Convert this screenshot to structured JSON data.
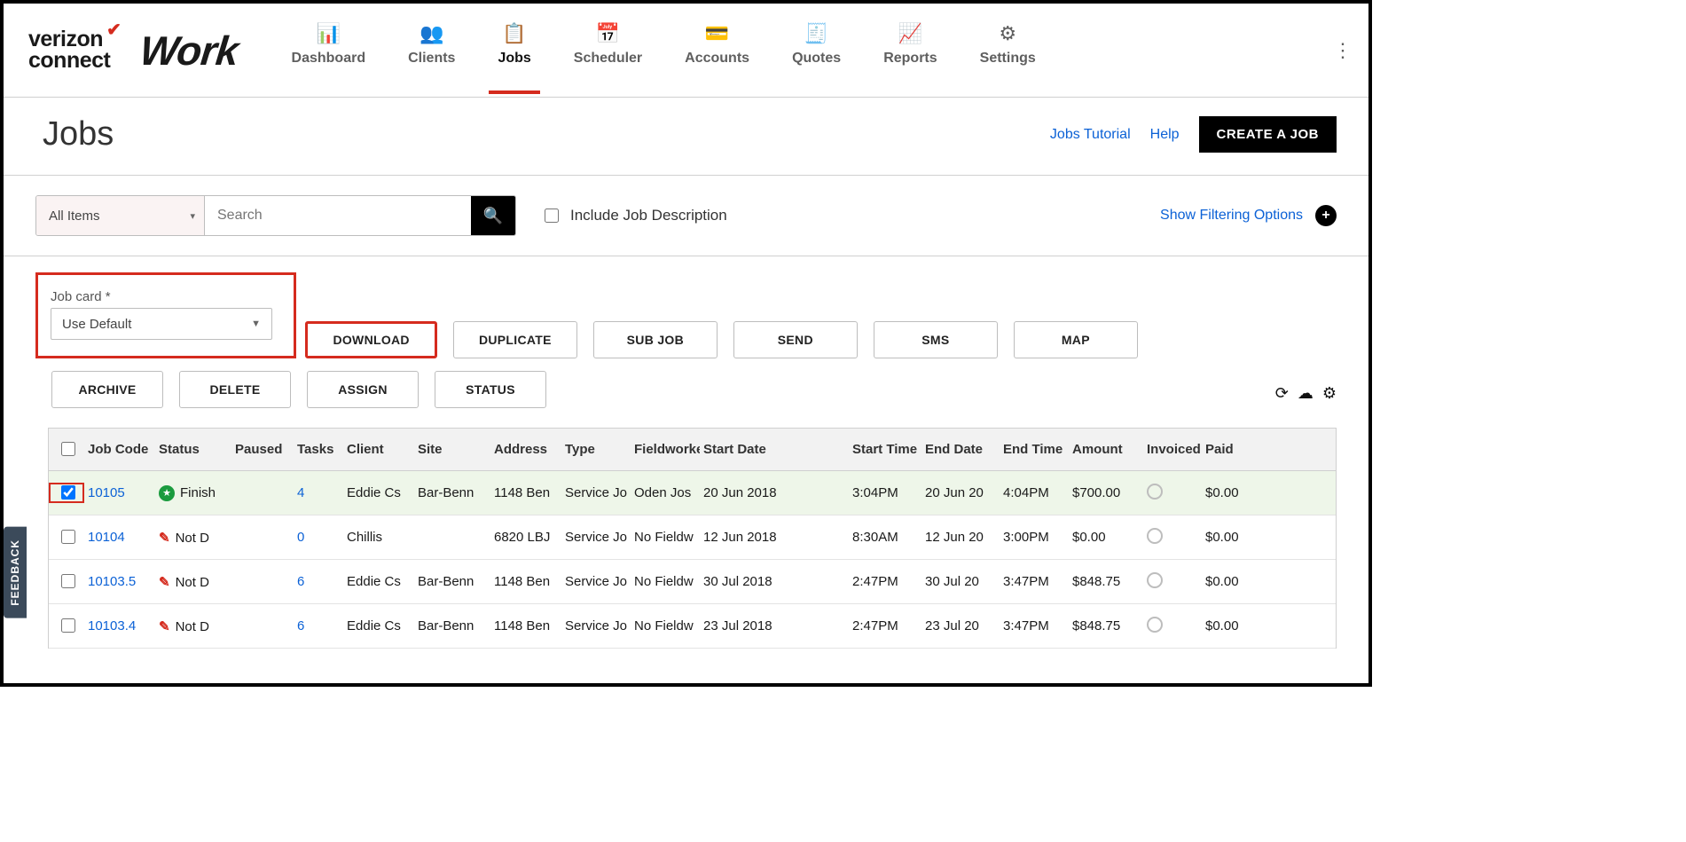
{
  "brand": {
    "line1": "verizon",
    "line2": "connect",
    "app": "Work"
  },
  "nav": [
    {
      "label": "Dashboard",
      "icon": "📊"
    },
    {
      "label": "Clients",
      "icon": "👥"
    },
    {
      "label": "Jobs",
      "icon": "📋",
      "active": true
    },
    {
      "label": "Scheduler",
      "icon": "📅"
    },
    {
      "label": "Accounts",
      "icon": "💳"
    },
    {
      "label": "Quotes",
      "icon": "🧾"
    },
    {
      "label": "Reports",
      "icon": "📈"
    },
    {
      "label": "Settings",
      "icon": "⚙"
    }
  ],
  "page": {
    "title": "Jobs",
    "tutorial": "Jobs Tutorial",
    "help": "Help",
    "create": "CREATE A JOB"
  },
  "filter": {
    "scope": "All Items",
    "search_placeholder": "Search",
    "include_desc": "Include Job Description",
    "show_filters": "Show Filtering Options"
  },
  "toolbar": {
    "jobcard_label": "Job card *",
    "jobcard_value": "Use Default",
    "download": "DOWNLOAD",
    "duplicate": "DUPLICATE",
    "subjob": "SUB JOB",
    "send": "SEND",
    "sms": "SMS",
    "map": "MAP",
    "archive": "ARCHIVE",
    "delete": "DELETE",
    "assign": "ASSIGN",
    "status": "STATUS"
  },
  "columns": [
    "",
    "Job Code",
    "Status",
    "Paused",
    "Tasks",
    "Client",
    "Site",
    "Address",
    "Type",
    "Fieldworker",
    "Start Date",
    "Start Time",
    "End Date",
    "End Time",
    "Amount",
    "Invoiced",
    "Paid"
  ],
  "rows": [
    {
      "checked": true,
      "code": "10105",
      "status": "Finish",
      "status_kind": "fin",
      "tasks": "4",
      "client": "Eddie Cs",
      "site": "Bar-Benn",
      "address": "1148 Ben",
      "type": "Service Jo",
      "fw": "Oden Jos",
      "sdate": "20 Jun 2018",
      "stime": "3:04PM",
      "edate": "20 Jun 20",
      "etime": "4:04PM",
      "amount": "$700.00",
      "paid": "$0.00"
    },
    {
      "checked": false,
      "code": "10104",
      "status": "Not D",
      "status_kind": "not",
      "tasks": "0",
      "client": "Chillis",
      "site": "",
      "address": "6820 LBJ",
      "type": "Service Jo",
      "fw": "No Fieldw",
      "sdate": "12 Jun 2018",
      "stime": "8:30AM",
      "edate": "12 Jun 20",
      "etime": "3:00PM",
      "amount": "$0.00",
      "paid": "$0.00"
    },
    {
      "checked": false,
      "code": "10103.5",
      "status": "Not D",
      "status_kind": "not",
      "tasks": "6",
      "client": "Eddie Cs",
      "site": "Bar-Benn",
      "address": "1148 Ben",
      "type": "Service Jo",
      "fw": "No Fieldw",
      "sdate": "30 Jul 2018",
      "stime": "2:47PM",
      "edate": "30 Jul 20",
      "etime": "3:47PM",
      "amount": "$848.75",
      "paid": "$0.00"
    },
    {
      "checked": false,
      "code": "10103.4",
      "status": "Not D",
      "status_kind": "not",
      "tasks": "6",
      "client": "Eddie Cs",
      "site": "Bar-Benn",
      "address": "1148 Ben",
      "type": "Service Jo",
      "fw": "No Fieldw",
      "sdate": "23 Jul 2018",
      "stime": "2:47PM",
      "edate": "23 Jul 20",
      "etime": "3:47PM",
      "amount": "$848.75",
      "paid": "$0.00"
    }
  ],
  "feedback": "FEEDBACK"
}
